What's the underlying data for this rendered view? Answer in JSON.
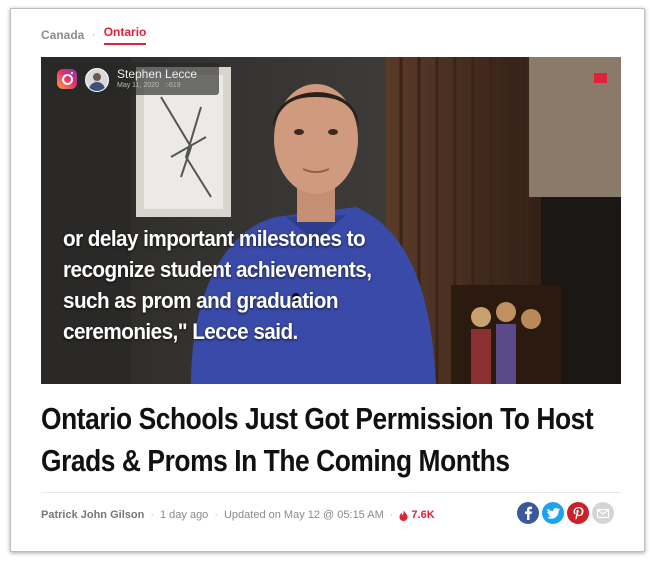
{
  "breadcrumb": {
    "parent": "Canada",
    "separator": "·",
    "current": "Ontario"
  },
  "video": {
    "account_name": "Stephen Lecce",
    "post_date": "May 11, 2020",
    "comment_count": "619",
    "caption_lines": [
      "or delay important milestones to",
      "recognize student achievements,",
      "such as prom and graduation",
      "ceremonies,\" Lecce said."
    ]
  },
  "article": {
    "headline_lines": [
      "Ontario Schools Just Got Permission To Host",
      "Grads & Proms In The Coming Months"
    ],
    "author": "Patrick John Gilson",
    "age": "1 day ago",
    "updated": "Updated on May 12 @ 05:15 AM",
    "hot_count": "7.6K"
  },
  "share": {
    "icons": [
      "facebook-icon",
      "twitter-icon",
      "pinterest-icon",
      "email-icon"
    ]
  },
  "colors": {
    "accent": "#e0213a",
    "facebook": "#3b5998",
    "twitter": "#1da1f2",
    "pinterest": "#cb2027",
    "email": "#d5d5d5"
  }
}
